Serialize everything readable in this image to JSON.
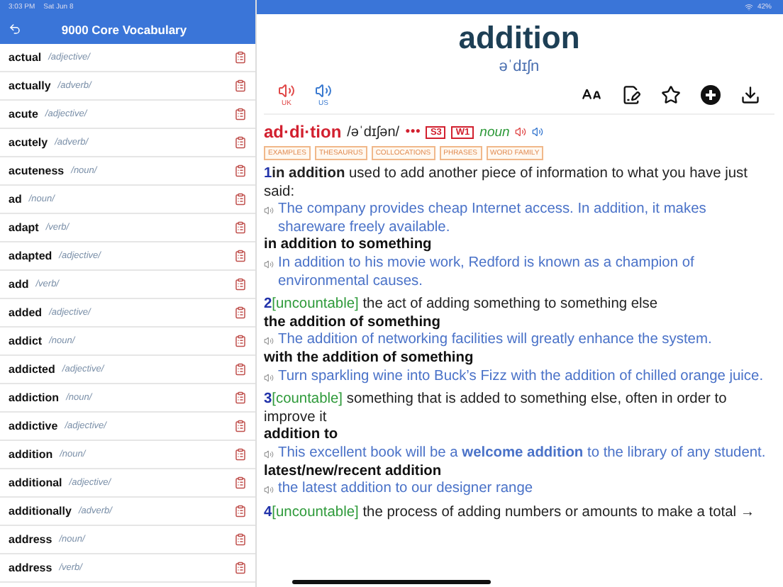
{
  "status_bar": {
    "time": "3:03 PM",
    "date": "Sat Jun 8",
    "battery": "42%"
  },
  "sidebar": {
    "title": "9000 Core Vocabulary",
    "items": [
      {
        "word": "actual",
        "pos": "/adjective/"
      },
      {
        "word": "actually",
        "pos": "/adverb/"
      },
      {
        "word": "acute",
        "pos": "/adjective/"
      },
      {
        "word": "acutely",
        "pos": "/adverb/"
      },
      {
        "word": "acuteness",
        "pos": "/noun/"
      },
      {
        "word": "ad",
        "pos": "/noun/"
      },
      {
        "word": "adapt",
        "pos": "/verb/"
      },
      {
        "word": "adapted",
        "pos": "/adjective/"
      },
      {
        "word": "add",
        "pos": "/verb/"
      },
      {
        "word": "added",
        "pos": "/adjective/"
      },
      {
        "word": "addict",
        "pos": "/noun/"
      },
      {
        "word": "addicted",
        "pos": "/adjective/"
      },
      {
        "word": "addiction",
        "pos": "/noun/"
      },
      {
        "word": "addictive",
        "pos": "/adjective/"
      },
      {
        "word": "addition",
        "pos": "/noun/"
      },
      {
        "word": "additional",
        "pos": "/adjective/"
      },
      {
        "word": "additionally",
        "pos": "/adverb/"
      },
      {
        "word": "address",
        "pos": "/noun/"
      },
      {
        "word": "address",
        "pos": "/verb/"
      }
    ]
  },
  "entry": {
    "headword": "addition",
    "pronunciation": "əˈdɪʃn",
    "audio": [
      {
        "label": "UK",
        "kind": "uk"
      },
      {
        "label": "US",
        "kind": "us"
      }
    ],
    "heading": {
      "syllables": "ad·di·tion",
      "ipa": "/əˈdɪʃən/",
      "frequency": "●●●",
      "badges": [
        "S3",
        "W1"
      ],
      "pos": "noun"
    },
    "tabs": [
      "EXAMPLES",
      "THESAURUS",
      "COLLOCATIONS",
      "PHRASES",
      "WORD FAMILY"
    ],
    "senses": [
      {
        "number": "1",
        "phrase": "in addition",
        "definition": "used to add another piece of information to what you have just said:",
        "blocks": [
          {
            "kind": "example",
            "text": "The company provides cheap Internet access. In addition, it makes shareware freely available."
          },
          {
            "kind": "pattern",
            "text": "in addition to something"
          },
          {
            "kind": "example",
            "text": "In addition to his movie work, Redford is known as a champion of environmental causes."
          }
        ]
      },
      {
        "number": "2",
        "grammar": "[uncountable]",
        "definition": "the act of adding something to something else",
        "blocks": [
          {
            "kind": "pattern",
            "text": "the addition of something"
          },
          {
            "kind": "example",
            "text": "The addition of networking facilities will greatly enhance the system."
          },
          {
            "kind": "pattern",
            "text": "with the addition of something"
          },
          {
            "kind": "example",
            "text": "Turn sparkling wine into Buck’s Fizz with the addition of chilled orange juice."
          }
        ]
      },
      {
        "number": "3",
        "grammar": "[countable]",
        "definition": "something that is added to something else, often in order to improve it",
        "blocks": [
          {
            "kind": "pattern",
            "text": "addition to"
          },
          {
            "kind": "example",
            "text": "This excellent book will be a **welcome addition** to the library of any student."
          },
          {
            "kind": "pattern",
            "text": "latest/new/recent addition"
          },
          {
            "kind": "example",
            "text": "the latest addition to our designer range"
          }
        ]
      },
      {
        "number": "4",
        "grammar": "[uncountable]",
        "definition": "the process of adding numbers or amounts to make a total →"
      }
    ]
  }
}
